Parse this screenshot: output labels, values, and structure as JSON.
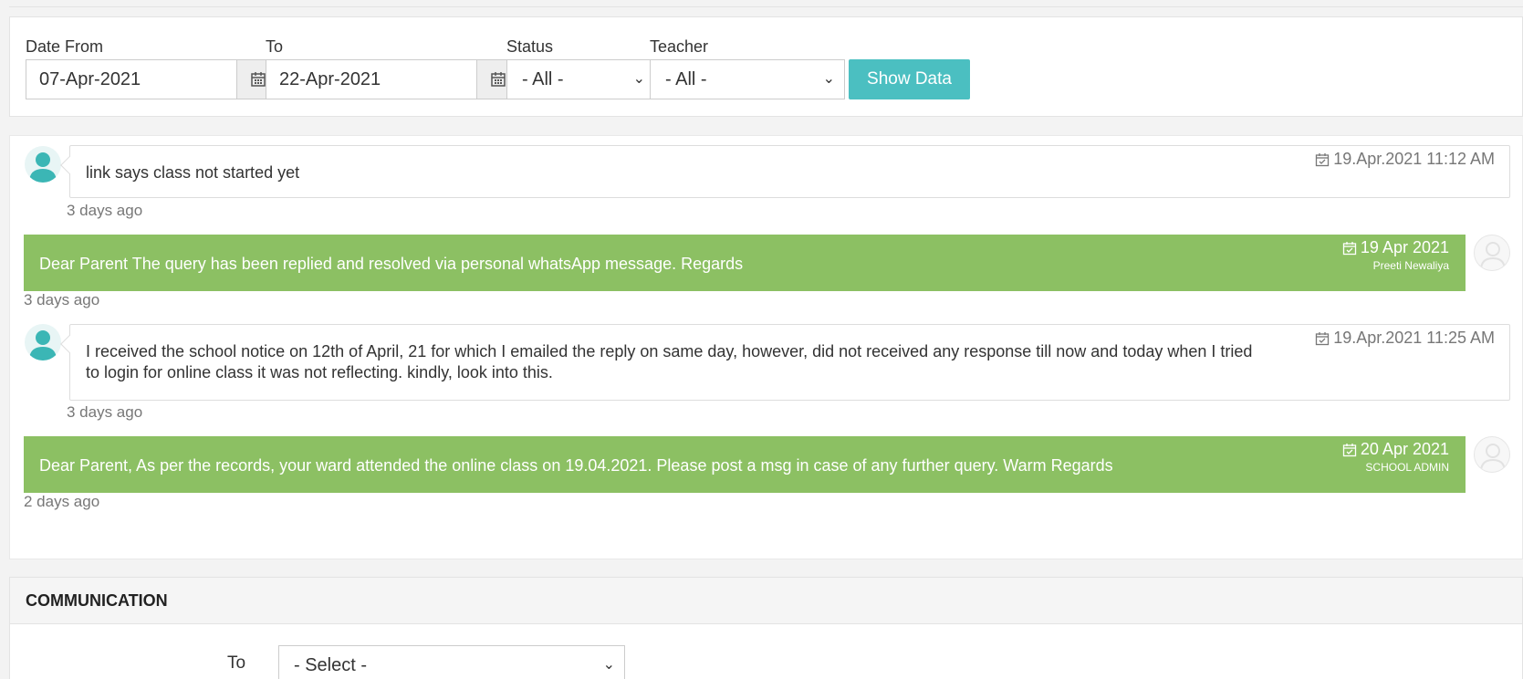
{
  "filters": {
    "date_from_label": "Date From",
    "date_from_value": "07-Apr-2021",
    "to_label": "To",
    "to_value": "22-Apr-2021",
    "status_label": "Status",
    "status_value": "- All -",
    "teacher_label": "Teacher",
    "teacher_value": "- All -",
    "show_button": "Show Data",
    "calendar_icon": "calendar-icon"
  },
  "messages": [
    {
      "type": "incoming",
      "text": "link says class not started yet",
      "timestamp": "19.Apr.2021 11:12 AM",
      "ago": "3 days ago"
    },
    {
      "type": "reply",
      "text": "Dear Parent The query has been replied and resolved via personal whatsApp message. Regards",
      "date": "19 Apr 2021",
      "author": "Preeti Newaliya",
      "ago": "3 days ago"
    },
    {
      "type": "incoming",
      "text_line1": "I received the school notice on 12th of April, 21 for which I emailed the reply on same day, however, did not received any response till now and today when I tried",
      "text_line2": "to login for online class it was not reflecting. kindly, look into this.",
      "timestamp": "19.Apr.2021 11:25 AM",
      "ago": "3 days ago"
    },
    {
      "type": "reply",
      "text": "Dear Parent, As per the records, your ward attended the online class on 19.04.2021. Please post a msg in case of any further query. Warm Regards",
      "date": "20 Apr 2021",
      "author": "SCHOOL ADMIN",
      "ago": "2 days ago"
    }
  ],
  "communication": {
    "title": "COMMUNICATION",
    "to_label": "To",
    "to_placeholder": "- Select -"
  },
  "colors": {
    "accent": "#4bbfc1",
    "reply_bg": "#8cc063"
  }
}
